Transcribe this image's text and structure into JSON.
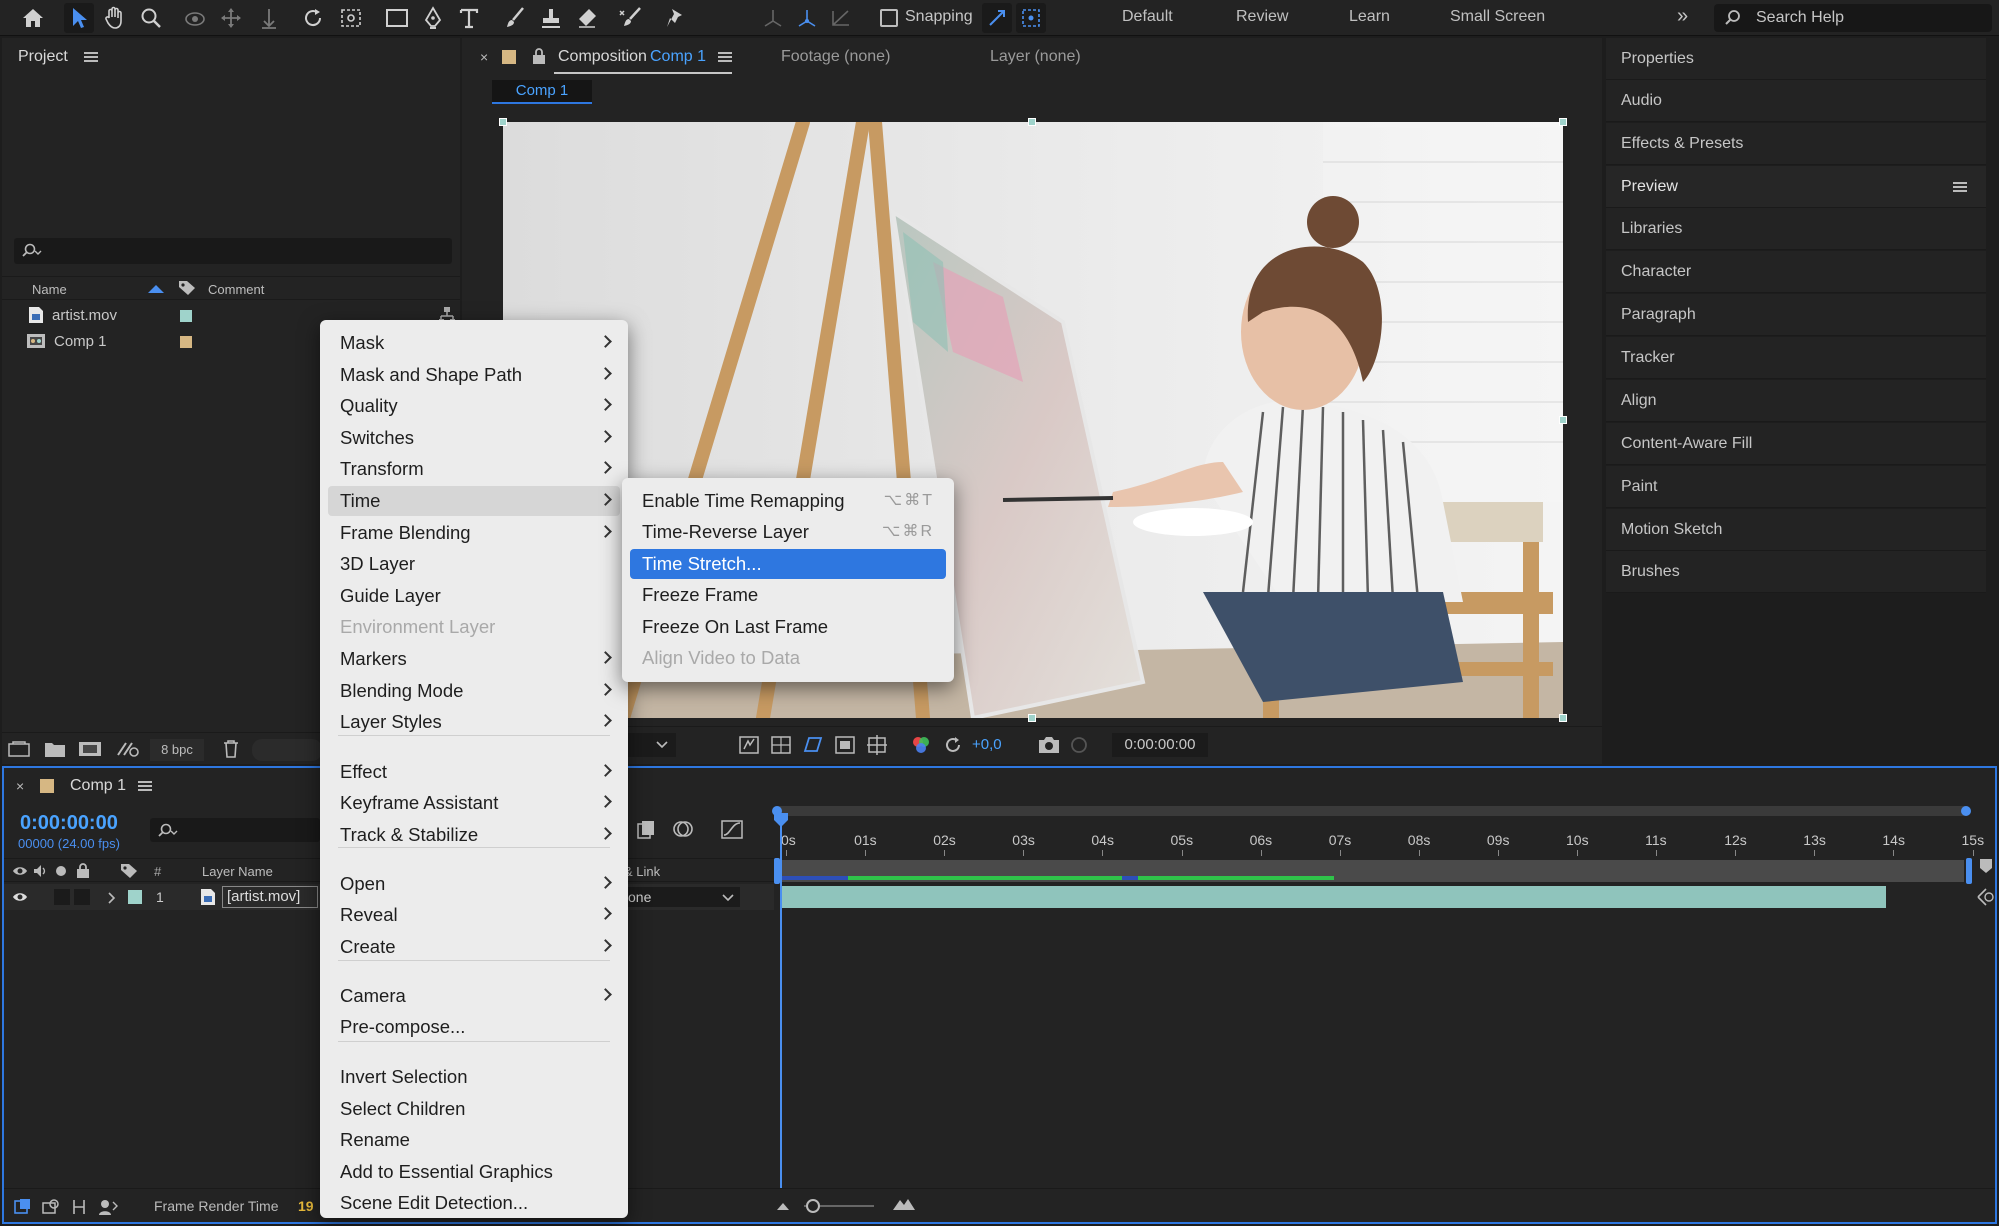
{
  "toolbar": {
    "snapping_label": "Snapping",
    "workspaces": [
      "Default",
      "Review",
      "Learn",
      "Small Screen"
    ],
    "search_placeholder": "Search Help"
  },
  "project": {
    "title": "Project",
    "columns": {
      "name": "Name",
      "comment": "Comment"
    },
    "items": [
      {
        "name": "artist.mov",
        "label_color": "#9fd3cb"
      },
      {
        "name": "Comp 1",
        "label_color": "#d6b783"
      }
    ],
    "bpc": "8 bpc"
  },
  "comp_viewer": {
    "tab_prefix": "Composition",
    "tab_name": "Comp 1",
    "footage_tab": "Footage (none)",
    "layer_tab": "Layer (none)",
    "breadcrumb": "Comp 1",
    "exposure": "+0,0",
    "timecode": "0:00:00:00"
  },
  "right_panel": {
    "items": [
      "Properties",
      "Audio",
      "Effects & Presets",
      "Preview",
      "Libraries",
      "Character",
      "Paragraph",
      "Tracker",
      "Align",
      "Content-Aware Fill",
      "Paint",
      "Motion Sketch",
      "Brushes"
    ]
  },
  "timeline": {
    "tab_name": "Comp 1",
    "timecode": "0:00:00:00",
    "frames": "00000 (24.00 fps)",
    "col_num": "#",
    "col_layer": "Layer Name",
    "col_parent": "& Link",
    "parent_value": "one",
    "layer_index": "1",
    "layer_name": "[artist.mov]",
    "ticks": [
      "0s",
      "01s",
      "02s",
      "03s",
      "04s",
      "05s",
      "06s",
      "07s",
      "08s",
      "09s",
      "10s",
      "11s",
      "12s",
      "13s",
      "14s",
      "15s"
    ],
    "status": "Frame Render Time",
    "status_value": "19"
  },
  "context_menu": {
    "items": [
      {
        "label": "Mask",
        "submenu": true
      },
      {
        "label": "Mask and Shape Path",
        "submenu": true
      },
      {
        "label": "Quality",
        "submenu": true
      },
      {
        "label": "Switches",
        "submenu": true
      },
      {
        "label": "Transform",
        "submenu": true
      },
      {
        "label": "Time",
        "submenu": true,
        "highlighted": true
      },
      {
        "label": "Frame Blending",
        "submenu": true
      },
      {
        "label": "3D Layer"
      },
      {
        "label": "Guide Layer"
      },
      {
        "label": "Environment Layer",
        "disabled": true
      },
      {
        "label": "Markers",
        "submenu": true
      },
      {
        "label": "Blending Mode",
        "submenu": true
      },
      {
        "label": "Layer Styles",
        "submenu": true
      },
      {
        "label": "Effect",
        "submenu": true
      },
      {
        "label": "Keyframe Assistant",
        "submenu": true
      },
      {
        "label": "Track & Stabilize",
        "submenu": true
      },
      {
        "label": "Open",
        "submenu": true
      },
      {
        "label": "Reveal",
        "submenu": true
      },
      {
        "label": "Create",
        "submenu": true
      },
      {
        "label": "Camera",
        "submenu": true
      },
      {
        "label": "Pre-compose..."
      },
      {
        "label": "Invert Selection"
      },
      {
        "label": "Select Children"
      },
      {
        "label": "Rename"
      },
      {
        "label": "Add to Essential Graphics"
      },
      {
        "label": "Scene Edit Detection..."
      }
    ]
  },
  "time_submenu": {
    "items": [
      {
        "label": "Enable Time Remapping",
        "shortcut": "⌥⌘T"
      },
      {
        "label": "Time-Reverse Layer",
        "shortcut": "⌥⌘R"
      },
      {
        "label": "Time Stretch...",
        "selected": true
      },
      {
        "label": "Freeze Frame"
      },
      {
        "label": "Freeze On Last Frame"
      },
      {
        "label": "Align Video to Data",
        "disabled": true
      }
    ]
  },
  "colors": {
    "accent": "#2e77e0",
    "timecode_blue": "#4aa3ff",
    "layer_bar": "#8fc4bc",
    "work_area_green": "#2fc34a"
  }
}
